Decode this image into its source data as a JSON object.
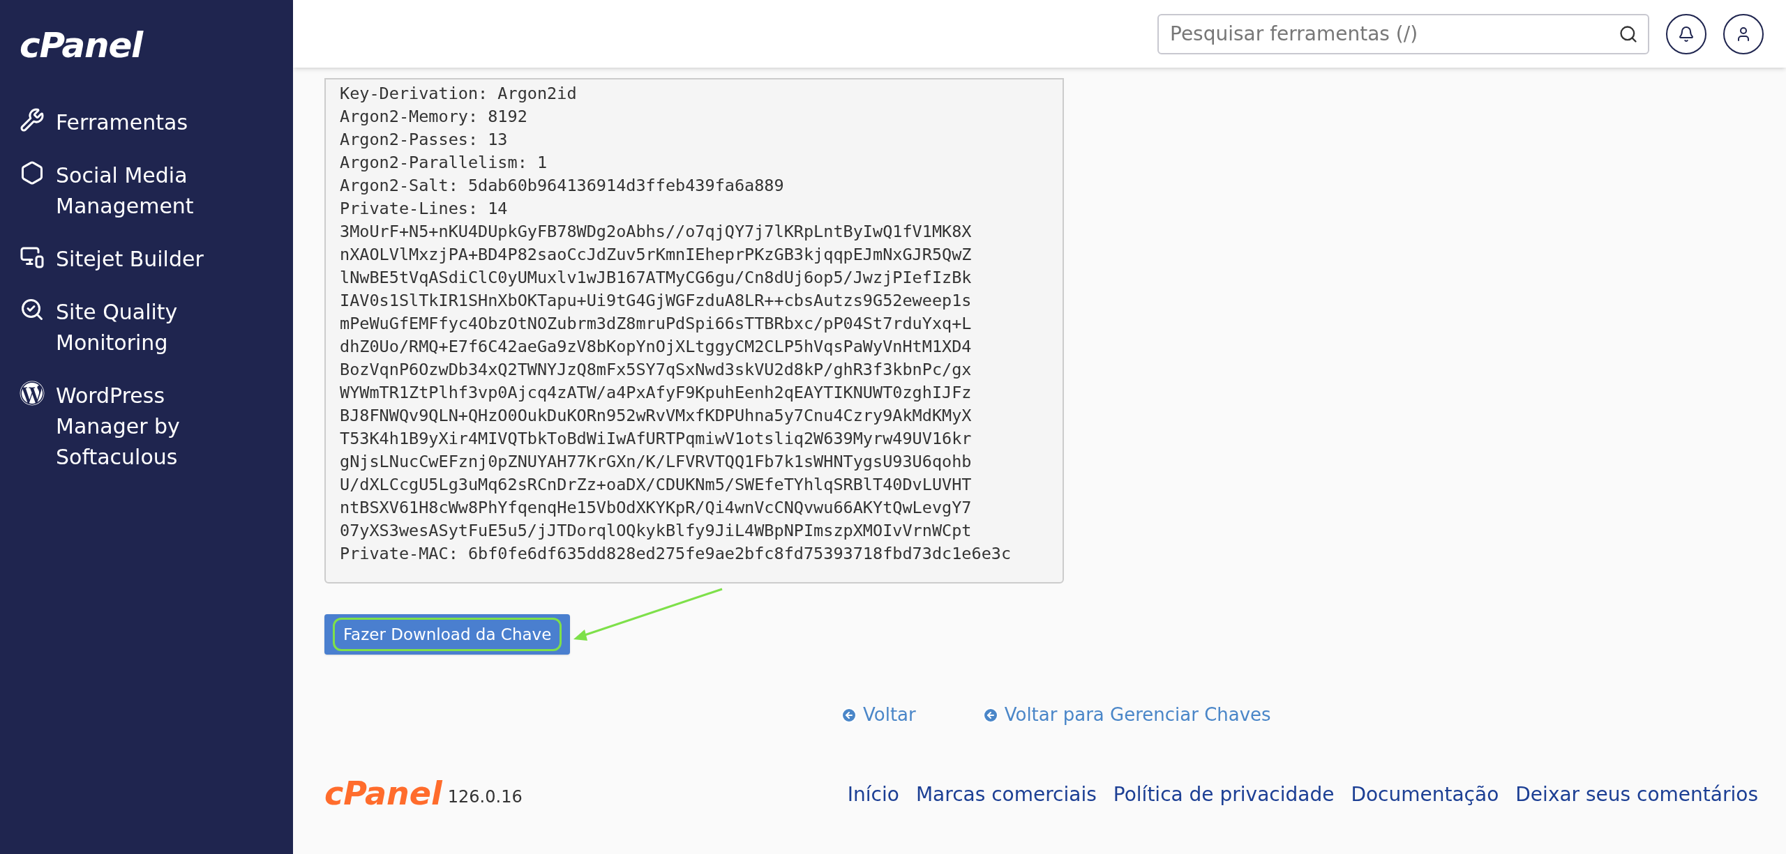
{
  "sidebar": {
    "logo": "cPanel",
    "items": [
      {
        "kind": "tools",
        "label": "Ferramentas"
      },
      {
        "kind": "social",
        "label": "Social Media Management"
      },
      {
        "kind": "sitejet",
        "label": "Sitejet Builder"
      },
      {
        "kind": "quality",
        "label": "Site Quality Monitoring"
      },
      {
        "kind": "wordpress",
        "label": "WordPress Manager by Softaculous"
      }
    ]
  },
  "header": {
    "search": {
      "placeholder": "Pesquisar ferramentas (/)"
    }
  },
  "key_text": {
    "lines": [
      "Key-Derivation: Argon2id",
      "Argon2-Memory: 8192",
      "Argon2-Passes: 13",
      "Argon2-Parallelism: 1",
      "Argon2-Salt: 5dab60b964136914d3ffeb439fa6a889",
      "Private-Lines: 14",
      "3MoUrF+N5+nKU4DUpkGyFB78WDg2oAbhs//o7qjQY7j7lKRpLntByIwQ1fV1MK8X",
      "nXAOLVlMxzjPA+BD4P82saoCcJdZuv5rKmnIEheprPKzGB3kjqqpEJmNxGJR5QwZ",
      "lNwBE5tVqASdiClC0yUMuxlv1wJB167ATMyCG6gu/Cn8dUj6op5/JwzjPIefIzBk",
      "IAV0s1SlTkIR1SHnXbOKTapu+Ui9tG4GjWGFzduA8LR++cbsAutzs9G52eweep1s",
      "mPeWuGfEMFfyc4ObzOtNOZubrm3dZ8mruPdSpi66sTTBRbxc/pP04St7rduYxq+L",
      "dhZ0Uo/RMQ+E7f6C42aeGa9zV8bKopYnOjXLtggyCM2CLP5hVqsPaWyVnHtM1XD4",
      "BozVqnP6OzwDb34xQ2TWNYJzQ8mFx5SY7qSxNwd3skVU2d8kP/ghR3f3kbnPc/gx",
      "WYWmTR1ZtPlhf3vp0Ajcq4zATW/a4PxAfyF9KpuhEenh2qEAYTIKNUWT0zghIJFz",
      "BJ8FNWQv9QLN+QHzO0OukDuKORn952wRvVMxfKDPUhna5y7Cnu4Czry9AkMdKMyX",
      "T53K4h1B9yXir4MIVQTbkToBdWiIwAfURTPqmiwV1otsliq2W639Myrw49UV16kr",
      "gNjsLNucCwEFznj0pZNUYAH77KrGXn/K/LFVRVTQQ1Fb7k1sWHNTygsU93U6qohb",
      "U/dXLCcgU5Lg3uMq62sRCnDrZz+oaDX/CDUKNm5/SWEfeTYhlqSRBlT40DvLUVHT",
      "ntBSXV61H8cWw8PhYfqenqHe15VbOdXKYKpR/Qi4wnVcCNQvwu66AKYtQwLevgY7",
      "07yXS3wesASytFuE5u5/jJTDorqlOQkykBlfy9JiL4WBpNPImszpXMOIvVrnWCpt",
      "Private-MAC: 6bf0fe6df635dd828ed275fe9ae2bfc8fd75393718fbd73dc1e6e3c"
    ]
  },
  "download_button": {
    "label": "Fazer Download da Chave",
    "highlighted": true
  },
  "back_links": [
    "Voltar",
    "Voltar para Gerenciar Chaves"
  ],
  "footer": {
    "logo": "cPanel",
    "version": "126.0.16",
    "links": [
      "Início",
      "Marcas comerciais",
      "Política de privacidade",
      "Documentação",
      "Deixar seus comentários"
    ]
  }
}
